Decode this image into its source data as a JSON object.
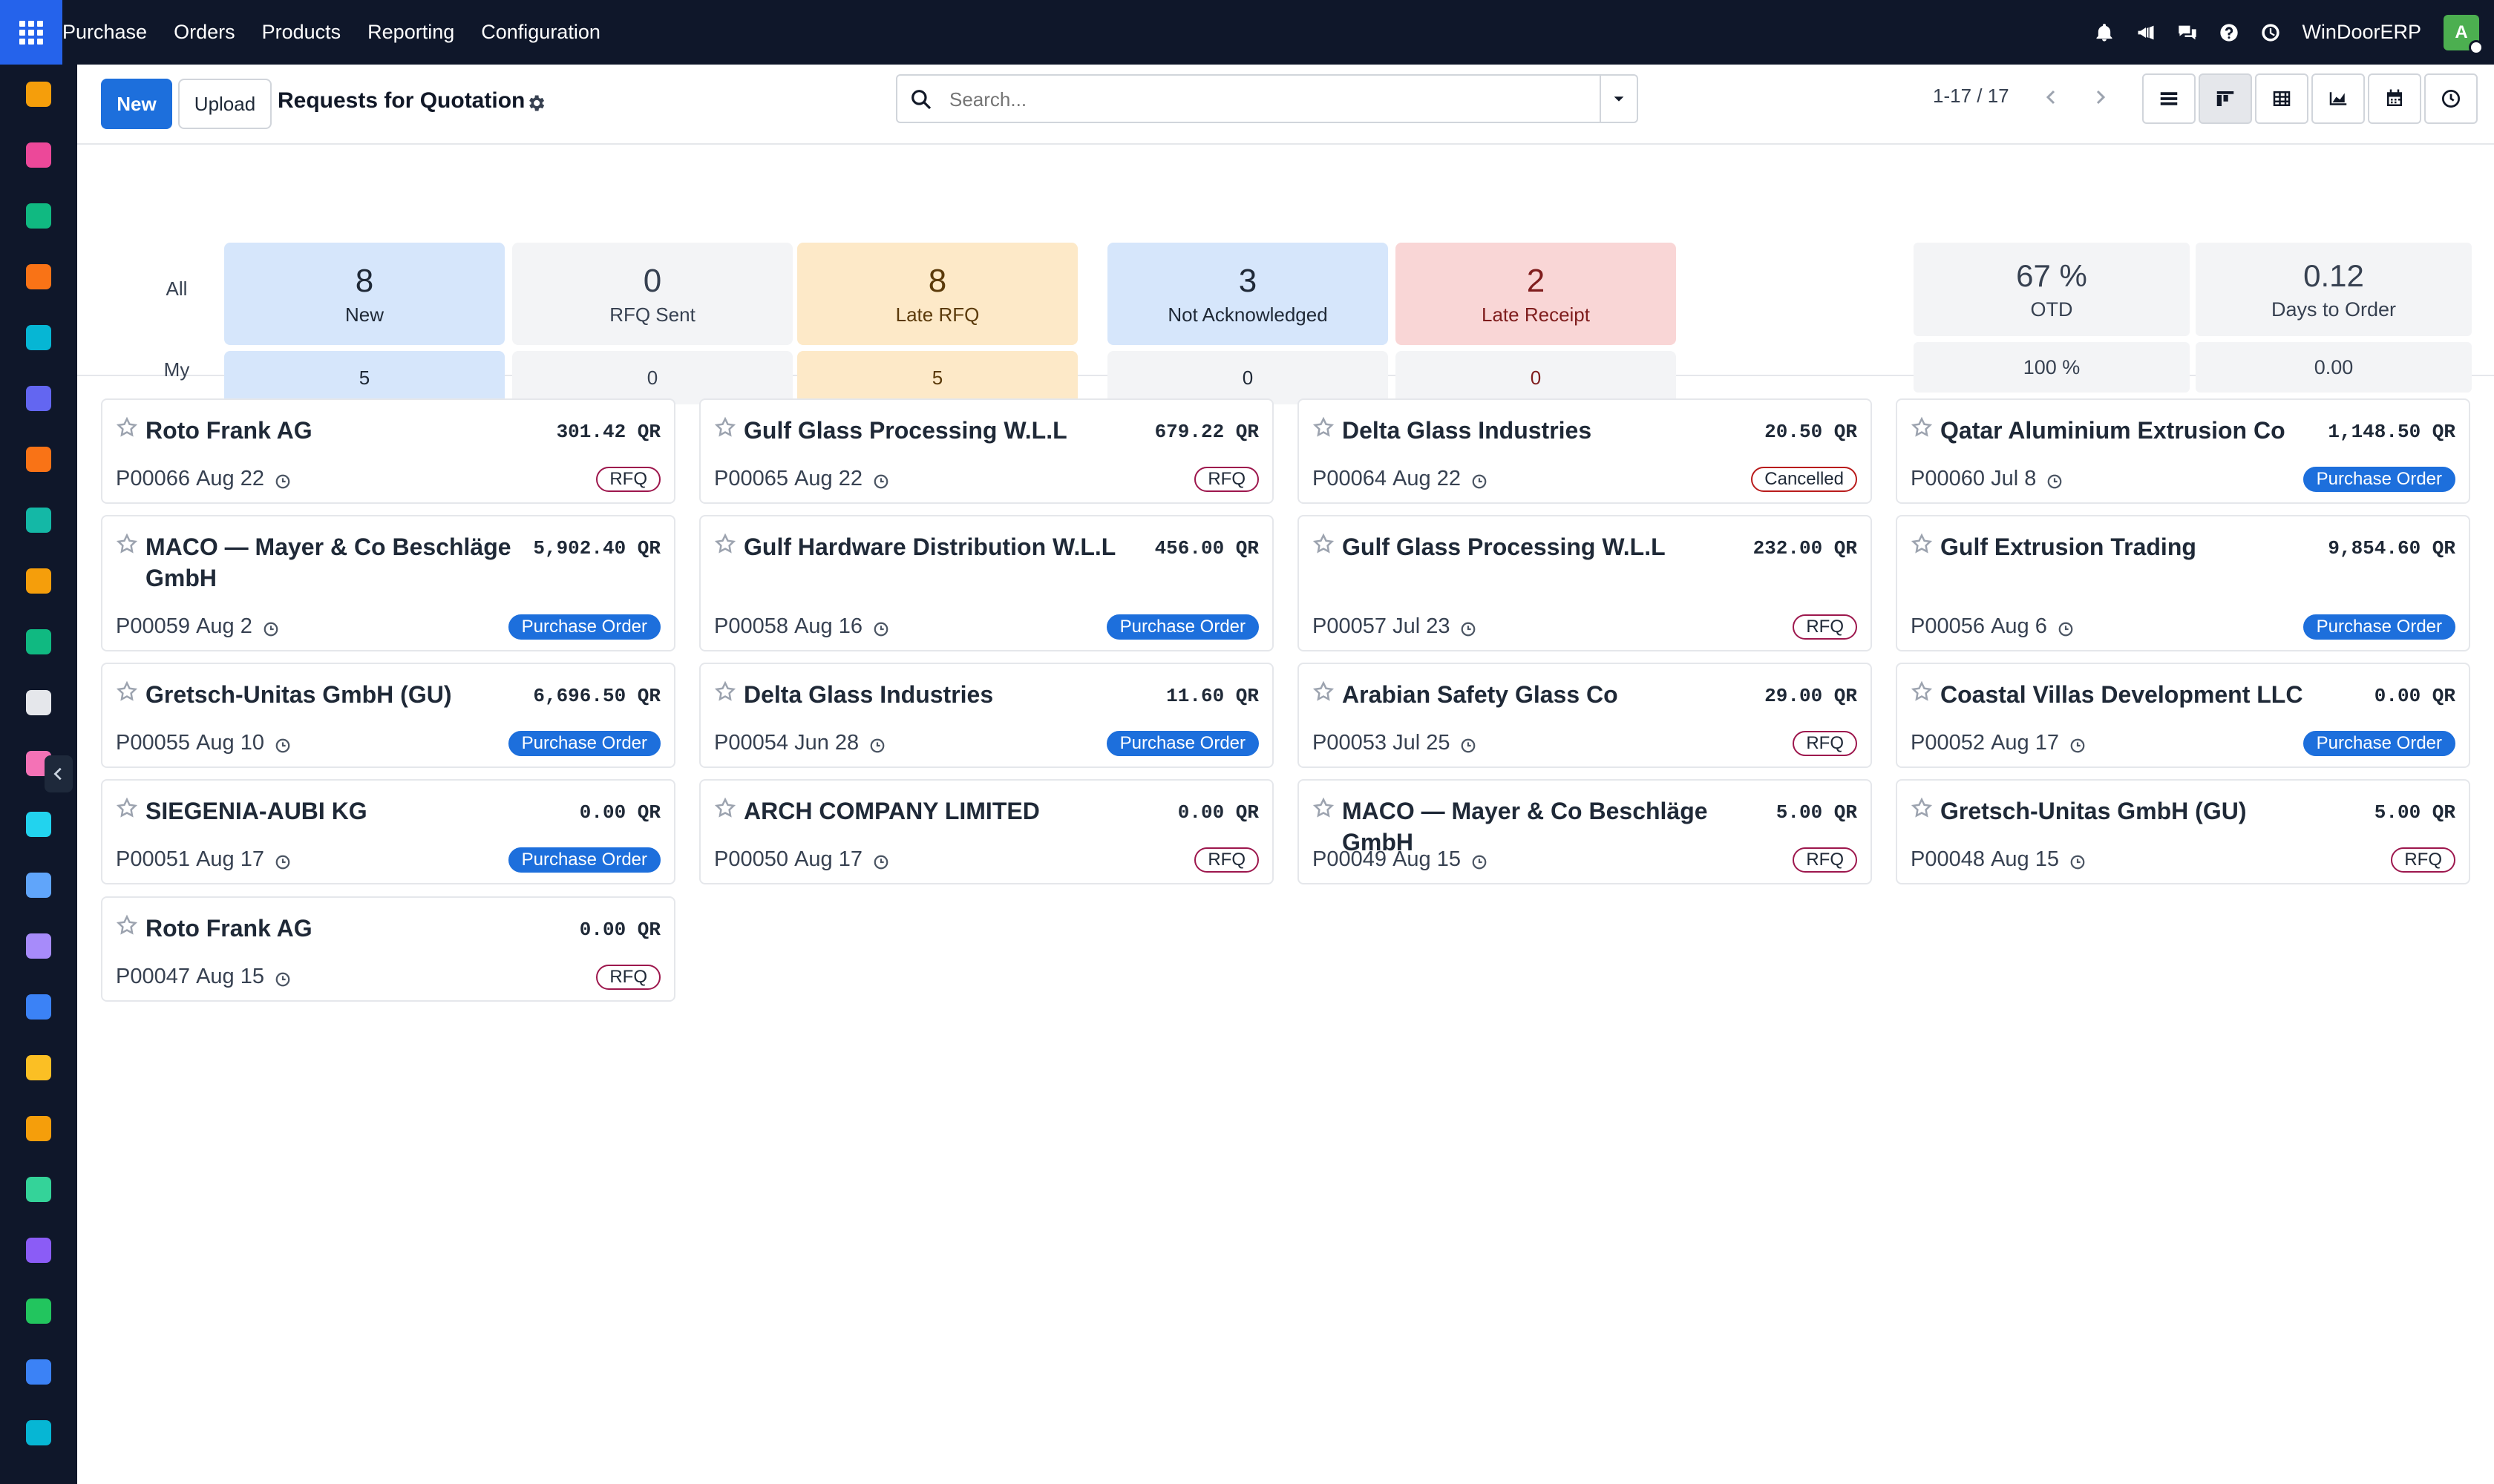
{
  "topbar": {
    "menu": [
      "Purchase",
      "Orders",
      "Products",
      "Reporting",
      "Configuration"
    ],
    "company": "WinDoorERP",
    "avatar_letter": "A",
    "icons": [
      "bell-icon",
      "megaphone-icon",
      "chat-icon",
      "help-icon",
      "activity-icon"
    ]
  },
  "sidebar": {
    "apps": [
      {
        "name": "app-dashboard-icon",
        "color": "#f59e0b"
      },
      {
        "name": "app-studio-icon",
        "color": "#ec4899"
      },
      {
        "name": "app-contacts-icon",
        "color": "#10b981"
      },
      {
        "name": "app-discuss-icon",
        "color": "#f97316"
      },
      {
        "name": "app-flow-icon",
        "color": "#06b6d4"
      },
      {
        "name": "app-mail-icon",
        "color": "#6366f1"
      },
      {
        "name": "app-livechat-icon",
        "color": "#f97316"
      },
      {
        "name": "app-documents-icon",
        "color": "#14b8a6"
      },
      {
        "name": "app-reports-icon",
        "color": "#f59e0b"
      },
      {
        "name": "app-employees-icon",
        "color": "#10b981"
      },
      {
        "name": "app-inventory-icon",
        "color": "#e5e7eb"
      },
      {
        "name": "app-tools-icon",
        "color": "#f472b6"
      },
      {
        "name": "app-tasks-icon",
        "color": "#22d3ee"
      },
      {
        "name": "app-knowledge-icon",
        "color": "#60a5fa"
      },
      {
        "name": "app-products-icon",
        "color": "#a78bfa"
      },
      {
        "name": "app-invoicing-icon",
        "color": "#3b82f6"
      },
      {
        "name": "app-team-icon",
        "color": "#fbbf24"
      },
      {
        "name": "app-calendar-icon",
        "color": "#f59e0b"
      },
      {
        "name": "app-sign-icon",
        "color": "#34d399"
      },
      {
        "name": "app-apps-icon",
        "color": "#8b5cf6"
      },
      {
        "name": "app-whatsapp-icon",
        "color": "#22c55e"
      },
      {
        "name": "app-timer-icon",
        "color": "#3b82f6"
      },
      {
        "name": "app-sync-icon",
        "color": "#06b6d4"
      }
    ]
  },
  "control_panel": {
    "new_label": "New",
    "upload_label": "Upload",
    "title": "Requests for Quotation",
    "search_placeholder": "Search...",
    "pager": "1-17 / 17"
  },
  "dashboard": {
    "row_all": "All",
    "row_my": "My",
    "tiles": [
      {
        "all": "8",
        "label": "New",
        "my": "5",
        "bg": "#d6e6fb",
        "fg": "#1f2937"
      },
      {
        "all": "0",
        "label": "RFQ Sent",
        "my": "0",
        "bg": "#f3f4f6",
        "fg": "#374151"
      },
      {
        "all": "8",
        "label": "Late RFQ",
        "my": "5",
        "bg": "#fde9c8",
        "fg": "#5b3a0a"
      },
      {
        "all": "3",
        "label": "Not Acknowledged",
        "my": "0",
        "bg": "#d6e6fb",
        "fg": "#1f2937",
        "my_bg": "#f3f4f6"
      },
      {
        "all": "2",
        "label": "Late Receipt",
        "my": "0",
        "bg": "#f9d6d6",
        "fg": "#7f1d1d",
        "my_bg": "#f3f4f6"
      }
    ],
    "kpis": [
      {
        "value": "67 %",
        "label": "OTD",
        "my": "100 %"
      },
      {
        "value": "0.12",
        "label": "Days to Order",
        "my": "0.00"
      }
    ]
  },
  "cards": [
    {
      "vendor": "Roto Frank AG",
      "amount": "301.42 QR",
      "ref": "P00066",
      "date": "Aug 22",
      "status": "RFQ"
    },
    {
      "vendor": "Gulf Glass Processing W.L.L",
      "amount": "679.22 QR",
      "ref": "P00065",
      "date": "Aug 22",
      "status": "RFQ"
    },
    {
      "vendor": "Delta Glass Industries",
      "amount": "20.50 QR",
      "ref": "P00064",
      "date": "Aug 22",
      "status": "Cancelled"
    },
    {
      "vendor": "Qatar Aluminium Extrusion Co",
      "amount": "1,148.50 QR",
      "ref": "P00060",
      "date": "Jul 8",
      "status": "Purchase Order"
    },
    {
      "vendor": "MACO — Mayer & Co Beschläge GmbH",
      "amount": "5,902.40 QR",
      "ref": "P00059",
      "date": "Aug 2",
      "status": "Purchase Order"
    },
    {
      "vendor": "Gulf Hardware Distribution W.L.L",
      "amount": "456.00 QR",
      "ref": "P00058",
      "date": "Aug 16",
      "status": "Purchase Order"
    },
    {
      "vendor": "Gulf Glass Processing W.L.L",
      "amount": "232.00 QR",
      "ref": "P00057",
      "date": "Jul 23",
      "status": "RFQ"
    },
    {
      "vendor": "Gulf Extrusion Trading",
      "amount": "9,854.60 QR",
      "ref": "P00056",
      "date": "Aug 6",
      "status": "Purchase Order"
    },
    {
      "vendor": "Gretsch-Unitas GmbH (GU)",
      "amount": "6,696.50 QR",
      "ref": "P00055",
      "date": "Aug 10",
      "status": "Purchase Order"
    },
    {
      "vendor": "Delta Glass Industries",
      "amount": "11.60 QR",
      "ref": "P00054",
      "date": "Jun 28",
      "status": "Purchase Order"
    },
    {
      "vendor": "Arabian Safety Glass Co",
      "amount": "29.00 QR",
      "ref": "P00053",
      "date": "Jul 25",
      "status": "RFQ"
    },
    {
      "vendor": "Coastal Villas Development LLC",
      "amount": "0.00 QR",
      "ref": "P00052",
      "date": "Aug 17",
      "status": "Purchase Order"
    },
    {
      "vendor": "SIEGENIA-AUBI KG",
      "amount": "0.00 QR",
      "ref": "P00051",
      "date": "Aug 17",
      "status": "Purchase Order"
    },
    {
      "vendor": "ARCH COMPANY LIMITED",
      "amount": "0.00 QR",
      "ref": "P00050",
      "date": "Aug 17",
      "status": "RFQ"
    },
    {
      "vendor": "MACO — Mayer & Co Beschläge GmbH",
      "amount": "5.00 QR",
      "ref": "P00049",
      "date": "Aug 15",
      "status": "RFQ"
    },
    {
      "vendor": "Gretsch-Unitas GmbH (GU)",
      "amount": "5.00 QR",
      "ref": "P00048",
      "date": "Aug 15",
      "status": "RFQ"
    },
    {
      "vendor": "Roto Frank AG",
      "amount": "0.00 QR",
      "ref": "P00047",
      "date": "Aug 15",
      "status": "RFQ"
    }
  ]
}
